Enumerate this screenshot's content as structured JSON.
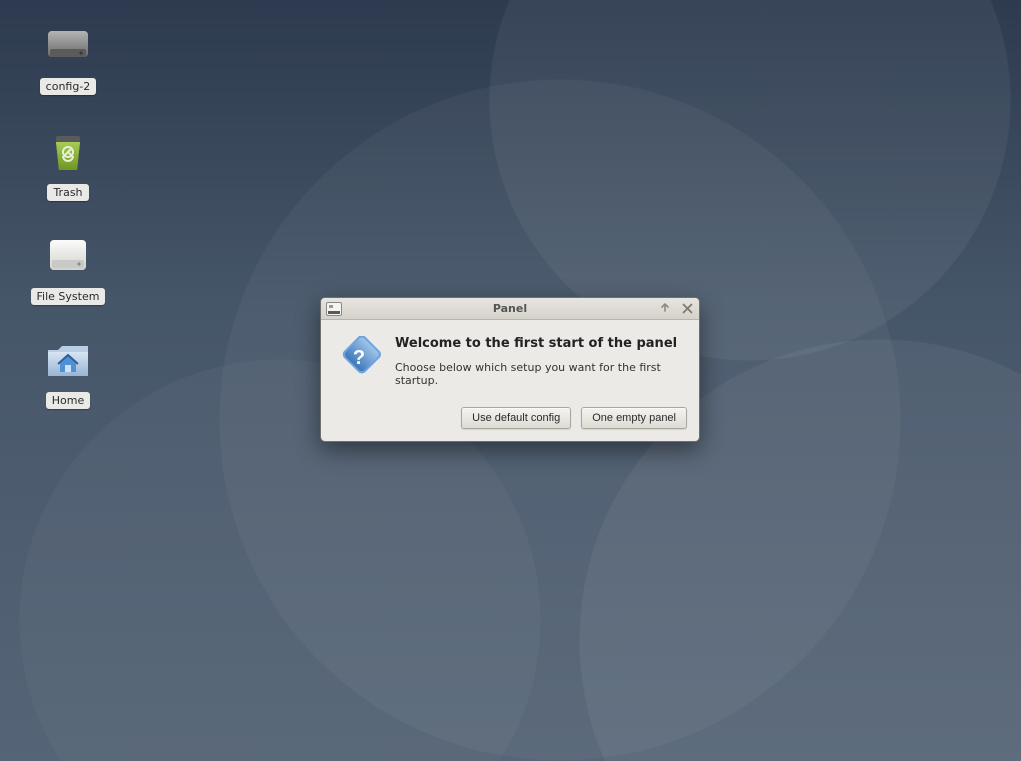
{
  "desktop": {
    "icons": [
      {
        "name": "config-2",
        "label": "config-2"
      },
      {
        "name": "trash",
        "label": "Trash"
      },
      {
        "name": "filesystem",
        "label": "File System"
      },
      {
        "name": "home",
        "label": "Home"
      }
    ]
  },
  "dialog": {
    "title": "Panel",
    "heading": "Welcome to the first start of the panel",
    "message": "Choose below which setup you want for the first startup.",
    "buttons": {
      "default_config": "Use default config",
      "empty_panel": "One empty panel"
    }
  }
}
